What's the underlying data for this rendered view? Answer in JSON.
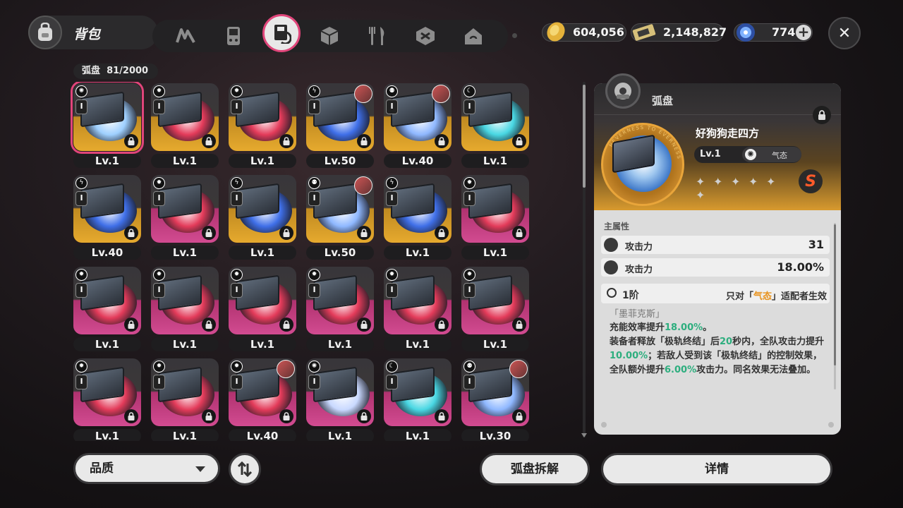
{
  "header": {
    "title": "背包",
    "tabs": [
      "drive-tab",
      "console-tab",
      "disk-tab",
      "material-tab",
      "food-tab",
      "gift-tab",
      "furniture-tab"
    ],
    "active_tab": 2
  },
  "currencies": [
    {
      "name": "coin-icon",
      "value": "604,056"
    },
    {
      "name": "ticket-icon",
      "value": "2,148,827"
    },
    {
      "name": "energy-icon",
      "value": "774"
    }
  ],
  "inventory": {
    "label": "弧盘",
    "count": "81/2000",
    "items": [
      {
        "level": "Lv.1",
        "rarity": "gold",
        "attr": "✺",
        "avatar": false,
        "disc": "#9fd0ff",
        "selected": true
      },
      {
        "level": "Lv.1",
        "rarity": "gold",
        "attr": "✹",
        "avatar": false,
        "disc": "#e33b5a"
      },
      {
        "level": "Lv.1",
        "rarity": "gold",
        "attr": "✹",
        "avatar": false,
        "disc": "#e33b5a"
      },
      {
        "level": "Lv.50",
        "rarity": "gold",
        "attr": "ϟ",
        "avatar": true,
        "disc": "#3f6fe8"
      },
      {
        "level": "Lv.40",
        "rarity": "gold",
        "attr": "⚉",
        "avatar": true,
        "disc": "#8fb8ff"
      },
      {
        "level": "Lv.1",
        "rarity": "gold",
        "attr": "☾",
        "avatar": false,
        "disc": "#49d7e3"
      },
      {
        "level": "Lv.40",
        "rarity": "gold",
        "attr": "ϟ",
        "avatar": false,
        "disc": "#3f6fe8"
      },
      {
        "level": "Lv.1",
        "rarity": "purple",
        "attr": "✹",
        "avatar": false,
        "disc": "#e33b5a"
      },
      {
        "level": "Lv.1",
        "rarity": "gold",
        "attr": "ϟ",
        "avatar": false,
        "disc": "#3f6fe8"
      },
      {
        "level": "Lv.50",
        "rarity": "gold",
        "attr": "⚉",
        "avatar": true,
        "disc": "#8fb8ff"
      },
      {
        "level": "Lv.1",
        "rarity": "gold",
        "attr": "ϟ",
        "avatar": false,
        "disc": "#3f6fe8"
      },
      {
        "level": "Lv.1",
        "rarity": "purple",
        "attr": "✹",
        "avatar": false,
        "disc": "#e33b5a"
      },
      {
        "level": "Lv.1",
        "rarity": "purple",
        "attr": "✹",
        "avatar": false,
        "disc": "#e33b5a"
      },
      {
        "level": "Lv.1",
        "rarity": "purple",
        "attr": "✹",
        "avatar": false,
        "disc": "#e33b5a"
      },
      {
        "level": "Lv.1",
        "rarity": "purple",
        "attr": "✹",
        "avatar": false,
        "disc": "#e33b5a"
      },
      {
        "level": "Lv.1",
        "rarity": "purple",
        "attr": "✹",
        "avatar": false,
        "disc": "#e33b5a"
      },
      {
        "level": "Lv.1",
        "rarity": "purple",
        "attr": "✹",
        "avatar": false,
        "disc": "#e33b5a"
      },
      {
        "level": "Lv.1",
        "rarity": "purple",
        "attr": "✹",
        "avatar": false,
        "disc": "#e33b5a"
      },
      {
        "level": "Lv.1",
        "rarity": "purple",
        "attr": "✹",
        "avatar": false,
        "disc": "#e33b5a"
      },
      {
        "level": "Lv.1",
        "rarity": "purple",
        "attr": "✹",
        "avatar": false,
        "disc": "#e33b5a"
      },
      {
        "level": "Lv.40",
        "rarity": "purple",
        "attr": "✹",
        "avatar": true,
        "disc": "#e33b5a"
      },
      {
        "level": "Lv.1",
        "rarity": "purple",
        "attr": "✺",
        "avatar": false,
        "disc": "#c9d9ff"
      },
      {
        "level": "Lv.1",
        "rarity": "purple",
        "attr": "☾",
        "avatar": false,
        "disc": "#49d7e3"
      },
      {
        "level": "Lv.30",
        "rarity": "purple",
        "attr": "⚉",
        "avatar": true,
        "disc": "#8fb8ff"
      }
    ]
  },
  "filter": {
    "label": "品质"
  },
  "actions": {
    "dismantle": "弧盘拆解",
    "details": "详情"
  },
  "detail": {
    "category": "弧盘",
    "name": "好狗狗走四方",
    "level": "Lv.1",
    "attribute": "气态",
    "stars": 6,
    "grade": "S",
    "medal_text": "NEVERNESS TO EVERNESS",
    "main_stats_title": "主属性",
    "stats": [
      {
        "label": "攻击力",
        "value": "31"
      },
      {
        "label": "攻击力",
        "value": "18.00%"
      }
    ],
    "tier": "1阶",
    "effect_condition_pre": "只对「",
    "effect_condition_attr": "气态",
    "effect_condition_post": "」适配者生效",
    "set_name": "「墨菲克斯」",
    "desc_1a": "充能效率提升",
    "desc_1b": "18.00%",
    "desc_1c": "。",
    "desc_2a": "装备者释放「极轨终结」后",
    "desc_2b": "20",
    "desc_2c": "秒内，全队攻击力提升",
    "desc_2d": "10.00%",
    "desc_2e": "；若敌人受到该「极轨终结」的控制效果，全队额外提升",
    "desc_2f": "6.00%",
    "desc_2g": "攻击力。同名效果无法叠加。"
  },
  "colors": {
    "accent": "#e0457a",
    "gold": "#e6aa2e",
    "purple": "#d24b91",
    "highlight": "#2dae7e",
    "orange_text": "#e8931e"
  }
}
